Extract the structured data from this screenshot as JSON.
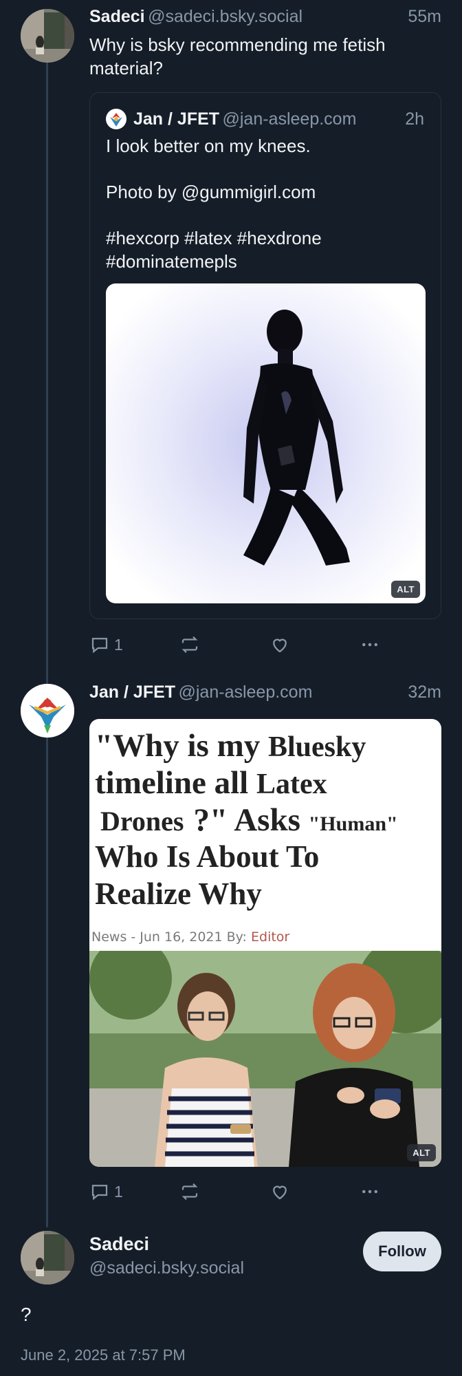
{
  "post1": {
    "author_name": "Sadeci",
    "author_handle": "@sadeci.bsky.social",
    "time": "55m",
    "text": "Why is bsky recommending me fetish material?",
    "quote": {
      "author_name": "Jan / JFET",
      "author_handle": "@jan-asleep.com",
      "time": "2h",
      "line1": "I look better on my knees.",
      "line2": "Photo by @gummigirl.com",
      "line3": "#hexcorp #latex #hexdrone",
      "line4": "#dominatemepls",
      "alt": "ALT"
    },
    "reply_count": "1"
  },
  "post2": {
    "author_name": "Jan / JFET",
    "author_handle": "@jan-asleep.com",
    "time": "32m",
    "headline": {
      "l1a": "\"Why is my ",
      "l1b": "Bluesky",
      "l2a": "timeline all ",
      "l2b": "Latex",
      "l3a": "Drones",
      "l3b": "?\" Asks ",
      "l3c": "\"Human\"",
      "l4": "Who Is About To",
      "l5": "Realize Why"
    },
    "meta_a": "News - Jun 16, 2021 By: ",
    "meta_b": "Editor",
    "alt": "ALT",
    "reply_count": "1"
  },
  "post3": {
    "author_name": "Sadeci",
    "author_handle": "@sadeci.bsky.social",
    "follow_label": "Follow",
    "text": "?",
    "timestamp": "June 2, 2025 at 7:57 PM"
  },
  "colors": {
    "background": "#151d28",
    "text_primary": "#f1f3f5",
    "text_secondary": "#8897a8",
    "thread_line": "#2e4052",
    "follow_button": "#dfe5ec"
  },
  "icons": [
    "reply-icon",
    "repost-icon",
    "like-icon",
    "more-icon"
  ]
}
